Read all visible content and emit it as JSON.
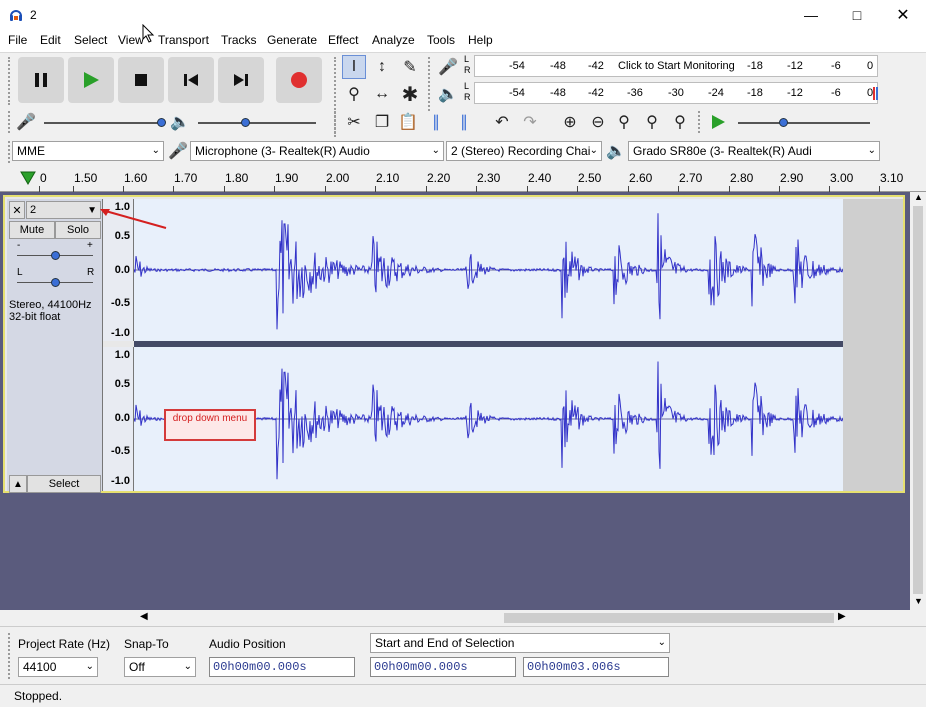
{
  "window": {
    "title": "2"
  },
  "menu": [
    "File",
    "Edit",
    "Select",
    "View",
    "Transport",
    "Tracks",
    "Generate",
    "Effect",
    "Analyze",
    "Tools",
    "Help"
  ],
  "meters": {
    "record_labels": [
      "-54",
      "-48",
      "-42",
      "Click to Start Monitoring",
      "-18",
      "-12",
      "-6",
      "0"
    ],
    "play_labels": [
      "-54",
      "-48",
      "-42",
      "-36",
      "-30",
      "-24",
      "-18",
      "-12",
      "-6",
      "0"
    ],
    "lr_top": "L",
    "lr_bottom": "R"
  },
  "device": {
    "host": "MME",
    "input": "Microphone (3- Realtek(R) Audio",
    "channels": "2 (Stereo) Recording Chai",
    "output": "Grado SR80e (3- Realtek(R) Audi"
  },
  "ruler": {
    "labels": [
      "0",
      "1.50",
      "1.60",
      "1.70",
      "1.80",
      "1.90",
      "2.00",
      "2.10",
      "2.20",
      "2.30",
      "2.40",
      "2.50",
      "2.60",
      "2.70",
      "2.80",
      "2.90",
      "3.00",
      "3.10"
    ]
  },
  "track": {
    "name": "2",
    "mute_label": "Mute",
    "solo_label": "Solo",
    "gain_minus": "-",
    "gain_plus": "+",
    "pan_left": "L",
    "pan_right": "R",
    "info_line1": "Stereo, 44100Hz",
    "info_line2": "32-bit float",
    "select_label": "Select",
    "y_labels": [
      "1.0",
      "0.5",
      "0.0",
      "-0.5",
      "-1.0"
    ]
  },
  "callout": {
    "text": "drop down menu"
  },
  "selection": {
    "project_rate_label": "Project Rate (Hz)",
    "project_rate_value": "44100",
    "snap_to_label": "Snap-To",
    "snap_to_value": "Off",
    "audio_position_label": "Audio Position",
    "audio_position_value": "00h00m00.000s",
    "selection_mode": "Start and End of Selection",
    "selection_start": "00h00m00.000s",
    "selection_end": "00h00m03.006s"
  },
  "status": {
    "text": "Stopped."
  },
  "colors": {
    "waveform": "#3232c8",
    "record": "#e03030",
    "play": "#2aa02a",
    "accent": "#3b6fd6"
  }
}
